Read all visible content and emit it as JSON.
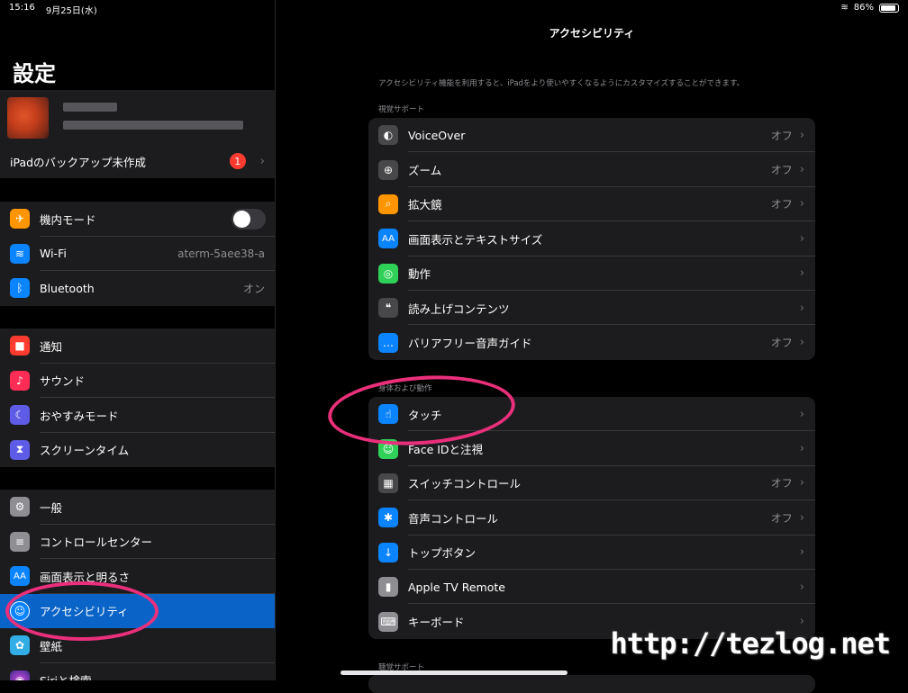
{
  "status_bar": {
    "time": "15:16",
    "date": "9月25日(水)",
    "battery": "86%"
  },
  "sidebar": {
    "title": "設定",
    "backup_label": "iPadのバックアップ未作成",
    "backup_badge": "1",
    "group1": [
      {
        "label": "機内モード",
        "icon": "airplane-icon",
        "color": "#ff9500",
        "glyph": "✈"
      },
      {
        "label": "Wi-Fi",
        "value": "aterm-5aee38-a",
        "icon": "wifi-icon",
        "color": "#0a84ff",
        "glyph": "≋"
      },
      {
        "label": "Bluetooth",
        "value": "オン",
        "icon": "bluetooth-icon",
        "color": "#0a84ff",
        "glyph": "ᛒ"
      }
    ],
    "group2": [
      {
        "label": "通知",
        "icon": "notifications-icon",
        "color": "#ff3b30",
        "glyph": "■"
      },
      {
        "label": "サウンド",
        "icon": "sound-icon",
        "color": "#ff2d55",
        "glyph": "♪"
      },
      {
        "label": "おやすみモード",
        "icon": "moon-icon",
        "color": "#5e5ce6",
        "glyph": "☾"
      },
      {
        "label": "スクリーンタイム",
        "icon": "hourglass-icon",
        "color": "#5e5ce6",
        "glyph": "⧗"
      }
    ],
    "group3": [
      {
        "label": "一般",
        "icon": "gear-icon",
        "color": "#8e8e93",
        "glyph": "⚙"
      },
      {
        "label": "コントロールセンター",
        "icon": "toggles-icon",
        "color": "#8e8e93",
        "glyph": "≡"
      },
      {
        "label": "画面表示と明るさ",
        "icon": "display-icon",
        "color": "#0a84ff",
        "glyph": "AA"
      },
      {
        "label": "アクセシビリティ",
        "icon": "accessibility-icon",
        "color": "#0a84ff",
        "glyph": "☺"
      },
      {
        "label": "壁紙",
        "icon": "wallpaper-icon",
        "color": "#32ade6",
        "glyph": "✿"
      },
      {
        "label": "Siriと検索",
        "icon": "siri-icon",
        "color": "#333",
        "glyph": "◉"
      }
    ]
  },
  "main": {
    "title": "アクセシビリティ",
    "description": "アクセシビリティ機能を利用すると、iPadをより使いやすくなるようにカスタマイズすることができます。",
    "section1_header": "視覚サポート",
    "section1": [
      {
        "label": "VoiceOver",
        "value": "オフ",
        "icon": "voiceover-icon",
        "color": "#48484a",
        "glyph": "◐"
      },
      {
        "label": "ズーム",
        "value": "オフ",
        "icon": "zoom-icon",
        "color": "#48484a",
        "glyph": "⊕"
      },
      {
        "label": "拡大鏡",
        "value": "オフ",
        "icon": "magnifier-icon",
        "color": "#ff9500",
        "glyph": "⌕"
      },
      {
        "label": "画面表示とテキストサイズ",
        "value": "",
        "icon": "text-size-icon",
        "color": "#0a84ff",
        "glyph": "AA"
      },
      {
        "label": "動作",
        "value": "",
        "icon": "motion-icon",
        "color": "#30d158",
        "glyph": "◎"
      },
      {
        "label": "読み上げコンテンツ",
        "value": "",
        "icon": "spoken-content-icon",
        "color": "#48484a",
        "glyph": "❝"
      },
      {
        "label": "バリアフリー音声ガイド",
        "value": "オフ",
        "icon": "audio-description-icon",
        "color": "#0a84ff",
        "glyph": "…"
      }
    ],
    "section2_header": "身体および動作",
    "section2": [
      {
        "label": "タッチ",
        "value": "",
        "icon": "touch-icon",
        "color": "#0a84ff",
        "glyph": "☝"
      },
      {
        "label": "Face IDと注視",
        "value": "",
        "icon": "faceid-icon",
        "color": "#30d158",
        "glyph": "☺"
      },
      {
        "label": "スイッチコントロール",
        "value": "オフ",
        "icon": "switch-control-icon",
        "color": "#48484a",
        "glyph": "▦"
      },
      {
        "label": "音声コントロール",
        "value": "オフ",
        "icon": "voice-control-icon",
        "color": "#0a84ff",
        "glyph": "✱"
      },
      {
        "label": "トップボタン",
        "value": "",
        "icon": "top-button-icon",
        "color": "#0a84ff",
        "glyph": "↓"
      },
      {
        "label": "Apple TV Remote",
        "value": "",
        "icon": "remote-icon",
        "color": "#8e8e93",
        "glyph": "▮"
      },
      {
        "label": "キーボード",
        "value": "",
        "icon": "keyboard-icon",
        "color": "#8e8e93",
        "glyph": "⌨"
      }
    ],
    "section3_header": "聴覚サポート"
  },
  "watermark": "http://tezlog.net"
}
